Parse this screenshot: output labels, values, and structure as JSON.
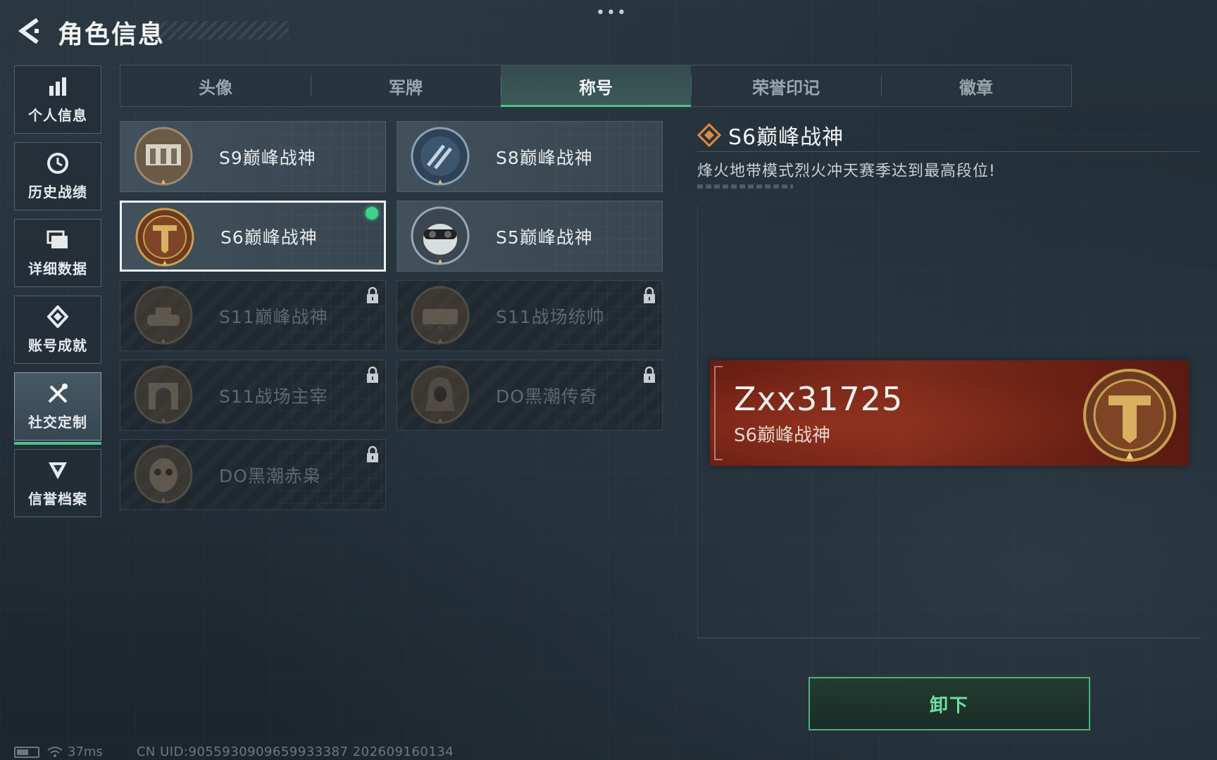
{
  "header": {
    "title": "角色信息",
    "menu_dots": "•••"
  },
  "sidebar": {
    "items": [
      {
        "label": "个人信息",
        "icon": "bar-chart-icon"
      },
      {
        "label": "历史战绩",
        "icon": "clock-icon"
      },
      {
        "label": "详细数据",
        "icon": "folder-icon"
      },
      {
        "label": "账号成就",
        "icon": "medal-icon"
      },
      {
        "label": "社交定制",
        "icon": "tools-icon",
        "active": true
      },
      {
        "label": "信誉档案",
        "icon": "shield-icon"
      }
    ]
  },
  "tabs": [
    {
      "label": "头像"
    },
    {
      "label": "军牌"
    },
    {
      "label": "称号",
      "active": true
    },
    {
      "label": "荣誉印记"
    },
    {
      "label": "徽章"
    }
  ],
  "titles": [
    {
      "label": "S9巅峰战神",
      "locked": false,
      "badge": "arena-badge"
    },
    {
      "label": "S8巅峰战神",
      "locked": false,
      "badge": "blue-stripe-badge"
    },
    {
      "label": "S6巅峰战神",
      "locked": false,
      "selected": true,
      "equipped": true,
      "badge": "gold-t-badge"
    },
    {
      "label": "S5巅峰战神",
      "locked": false,
      "badge": "skull-goggles-badge"
    },
    {
      "label": "S11巅峰战神",
      "locked": true,
      "badge": "tank-badge"
    },
    {
      "label": "S11战场统帅",
      "locked": true,
      "badge": "apc-badge"
    },
    {
      "label": "S11战场主宰",
      "locked": true,
      "badge": "arch-badge"
    },
    {
      "label": "DO黑潮传奇",
      "locked": true,
      "badge": "hooded-figure-badge"
    },
    {
      "label": "DO黑潮赤枭",
      "locked": true,
      "badge": "owl-badge"
    }
  ],
  "detail": {
    "title": "S6巅峰战神",
    "description": "烽火地带模式烈火冲天赛季达到最高段位!"
  },
  "name_card": {
    "player_name": "Zxx31725",
    "title": "S6巅峰战神"
  },
  "actions": {
    "unequip_label": "卸下"
  },
  "footer": {
    "ping": "37ms",
    "uid": "CN UID:9055930909659933387 202609160134"
  },
  "colors": {
    "accent": "#4fc28a",
    "name_card_bg": "#7d2a1b",
    "gold": "#c9a050"
  }
}
